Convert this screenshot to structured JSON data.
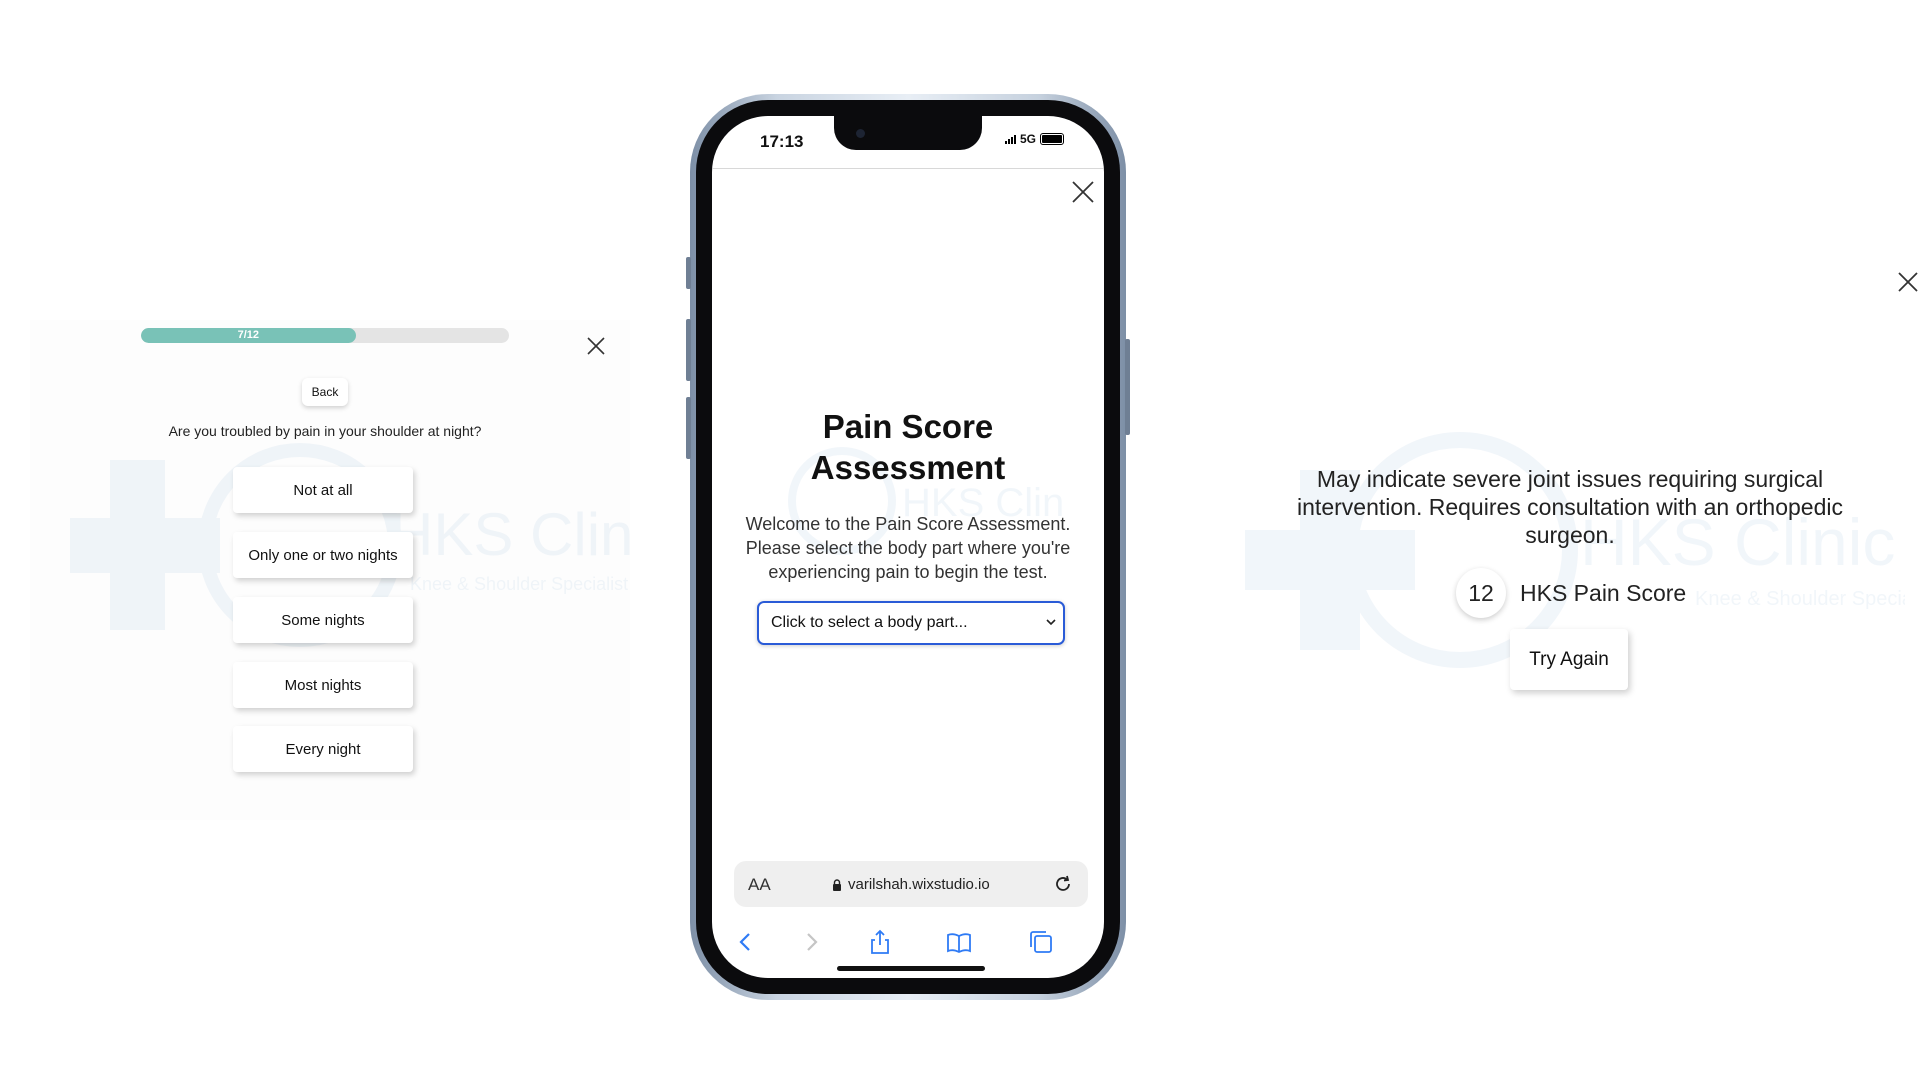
{
  "left": {
    "progress_label": "7/12",
    "progress_fraction": 0.5833,
    "back_label": "Back",
    "question": "Are you troubled by pain in your shoulder at night?",
    "options": [
      "Not at all",
      "Only one or two nights",
      "Some nights",
      "Most nights",
      "Every night"
    ],
    "watermark_text": "HKS Clinic",
    "watermark_subtext": "Knee & Shoulder Specialist"
  },
  "phone": {
    "time": "17:13",
    "network": "5G",
    "modal": {
      "title_line1": "Pain Score",
      "title_line2": "Assessment",
      "text_line1": "Welcome to the Pain Score Assessment.",
      "text_line2": "Please select the body part where you're",
      "text_line3": "experiencing pain to begin the test.",
      "select_placeholder": "Click to select a body part..."
    },
    "browser": {
      "aa_label": "AA",
      "url": "varilshah.wixstudio.io"
    }
  },
  "right": {
    "result_line1": "May indicate severe joint issues requiring surgical",
    "result_line2": "intervention. Requires consultation with an orthopedic",
    "result_line3": "surgeon.",
    "score": "12",
    "score_label": "HKS Pain Score",
    "try_again_label": "Try Again",
    "watermark_text": "HKS Clinic",
    "watermark_subtext": "Knee & Shoulder Specialist"
  },
  "colors": {
    "progress_fill": "#79c2b7",
    "progress_track": "#e4e4e4",
    "select_border": "#2a5bd7",
    "phone_frame": "#c9d4e1"
  }
}
